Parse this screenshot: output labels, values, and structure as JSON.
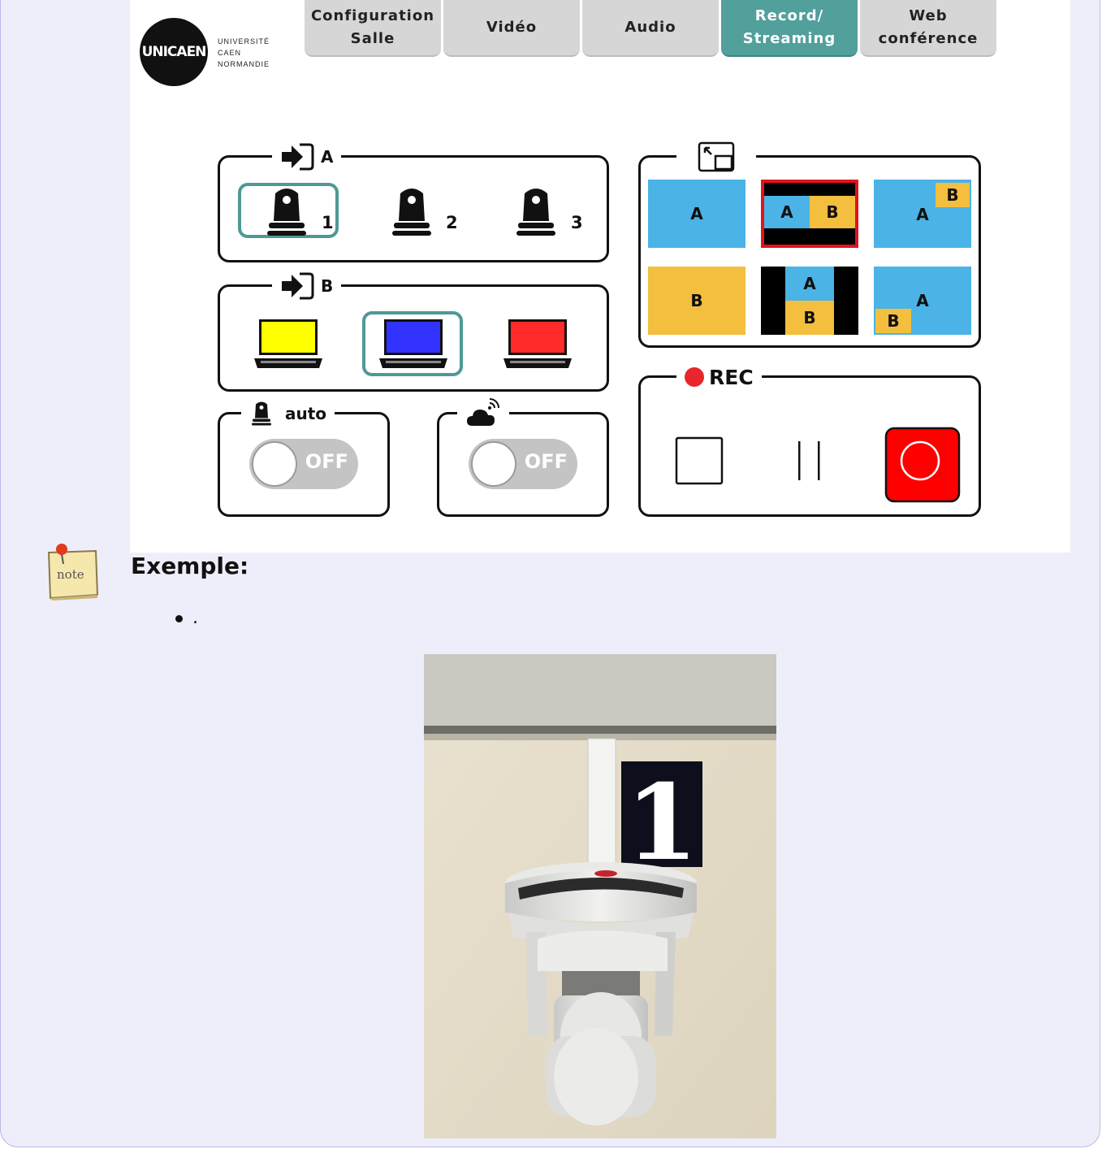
{
  "logo": {
    "mark": "UNICAEN",
    "lines": [
      "UNIVERSITÉ",
      "CAEN",
      "NORMANDIE"
    ]
  },
  "tabs": [
    {
      "label": "Configuration\nSalle",
      "active": false
    },
    {
      "label": "Vidéo",
      "active": false
    },
    {
      "label": "Audio",
      "active": false
    },
    {
      "label": "Record/\nStreaming",
      "active": true
    },
    {
      "label": "Web\nconférence",
      "active": false
    }
  ],
  "source_a": {
    "letter": "A",
    "cameras": [
      {
        "number": "1",
        "selected": true
      },
      {
        "number": "2",
        "selected": false
      },
      {
        "number": "3",
        "selected": false
      }
    ]
  },
  "source_b": {
    "letter": "B",
    "laptops": [
      {
        "screen_color": "#ffff00",
        "selected": false
      },
      {
        "screen_color": "#3333ff",
        "selected": true
      },
      {
        "screen_color": "#ff2a2a",
        "selected": false
      }
    ]
  },
  "auto_tracking": {
    "label": "auto",
    "toggle": "OFF"
  },
  "streaming": {
    "toggle": "OFF"
  },
  "layouts": {
    "icon": "picture-in-picture-icon",
    "tiles": [
      {
        "id": "a-full",
        "labels": [
          "A"
        ],
        "selected": false
      },
      {
        "id": "a-b-side",
        "labels": [
          "A",
          "B"
        ],
        "selected": true
      },
      {
        "id": "a-pip-b-top",
        "labels": [
          "A",
          "B"
        ],
        "selected": false
      },
      {
        "id": "b-full",
        "labels": [
          "B"
        ],
        "selected": false
      },
      {
        "id": "a-b-stacked",
        "labels": [
          "A",
          "B"
        ],
        "selected": false
      },
      {
        "id": "a-pip-b-bottom",
        "labels": [
          "A",
          "B"
        ],
        "selected": false
      }
    ]
  },
  "rec": {
    "label": "REC",
    "indicator_color": "#e8262b"
  },
  "colors": {
    "accent": "#52a09c",
    "source_a": "#4bb3e6",
    "source_b": "#f4be3e",
    "record": "#ff0000"
  },
  "note": {
    "title": "Exemple:",
    "bullet_text": ".",
    "icon": "note-pin-icon",
    "icon_text": "note"
  },
  "photo": {
    "sign_number": "1"
  }
}
